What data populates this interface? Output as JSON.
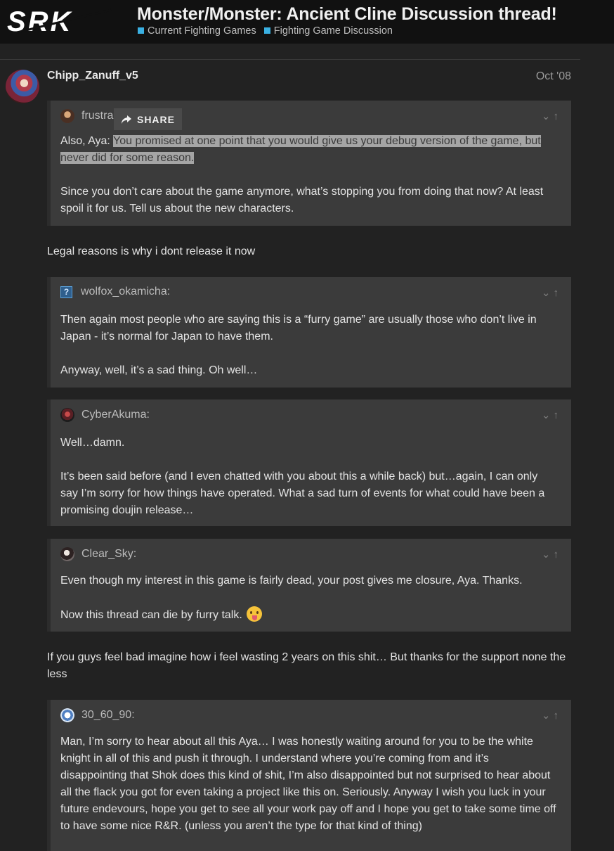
{
  "header": {
    "logo_text": "SRK",
    "title": "Monster/Monster: Ancient Cline Discussion thread!",
    "categories": [
      "Current Fighting Games",
      "Fighting Game Discussion"
    ],
    "category_color": "#3ab0e2"
  },
  "post": {
    "author": "Chipp_Zanuff_v5",
    "date": "Oct '08"
  },
  "share_button": {
    "label": "SHARE"
  },
  "quotes": [
    {
      "author": "frustra",
      "body": [
        {
          "prefix": "Also, Aya: ",
          "highlight": "You promised at one point that you would give us your debug version of the game, but never did for some reason."
        },
        {
          "text": "Since you don’t care about the game anymore, what’s stopping you from doing that now? At least spoil it for us. Tell us about the new characters."
        }
      ]
    },
    {
      "author": "wolfox_okamicha:",
      "body": [
        "Then again most people who are saying this is a “furry game” are usually those who don’t live in Japan - it’s normal for Japan to have them.",
        "Anyway, well, it’s a sad thing. Oh well…"
      ]
    },
    {
      "author": "CyberAkuma:",
      "body": [
        "Well…damn.",
        "It’s been said before (and I even chatted with you about this a while back) but…again, I can only say I’m sorry for how things have operated. What a sad turn of events for what could have been a promising doujin release…"
      ]
    },
    {
      "author": "Clear_Sky:",
      "body": [
        "Even though my interest in this game is fairly dead, your post gives me closure, Aya. Thanks.",
        "Now this thread can die by furry talk."
      ]
    },
    {
      "author": "30_60_90:",
      "body": [
        "Man, I’m sorry to hear about all this Aya… I was honestly waiting around for you to be the white knight in all of this and push it through. I understand where you’re coming from and it’s disappointing that Shok does this kind of shit, I’m also disappointed but not surprised to hear about all the flack you got for even taking a project like this on. Seriously. Anyway I wish you luck in your future endevours, hope you get to see all your work pay off and I hope you get to take some time off to have some nice R&R. (unless you aren’t the type for that kind of thing)"
      ]
    }
  ],
  "replies": [
    "Legal reasons is why i dont release it now",
    "If you guys feel bad imagine how i feel wasting 2 years on this shit… But thanks for the support none the less"
  ],
  "icons": {
    "quote_controls": [
      "chevron-down-icon",
      "arrow-up-icon"
    ],
    "emoji": "stuck-out-tongue-emoji"
  }
}
